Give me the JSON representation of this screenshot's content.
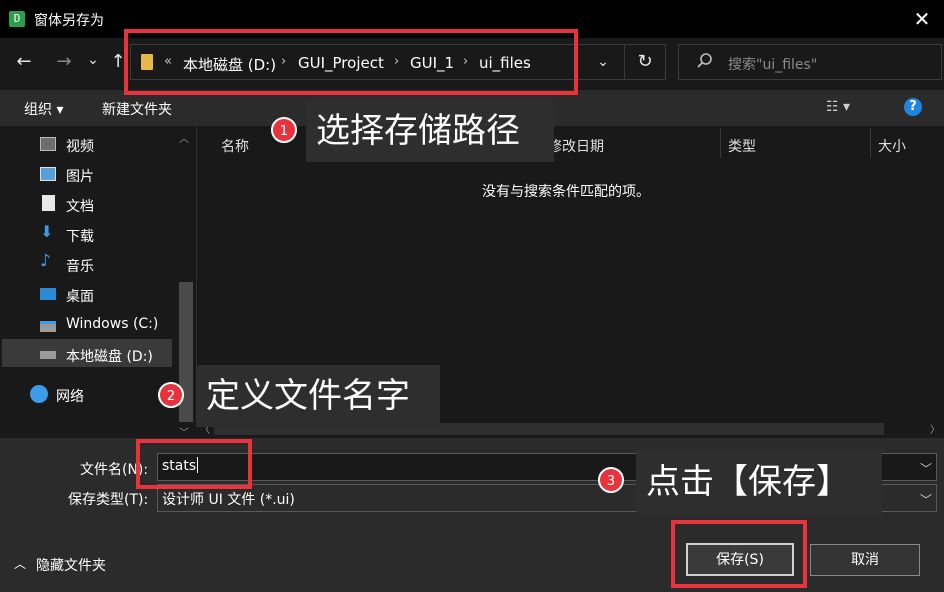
{
  "window": {
    "app_icon_letter": "D",
    "title": "窗体另存为",
    "close": "✕"
  },
  "nav": {
    "back": "←",
    "forward": "→",
    "recent": "⌄",
    "up": "↑",
    "breadcrumb_prefix": "«",
    "breadcrumbs": [
      "本地磁盘 (D:)",
      "GUI_Project",
      "GUI_1",
      "ui_files"
    ],
    "sep": "›",
    "dropdown": "⌄",
    "refresh": "↻",
    "search_placeholder": "搜索\"ui_files\""
  },
  "toolbar": {
    "organize": "组织 ▾",
    "new_folder": "新建文件夹",
    "view": "☷ ▾",
    "help": "?"
  },
  "sidebar": {
    "items": [
      {
        "label": "视频",
        "icon": "video-icon"
      },
      {
        "label": "图片",
        "icon": "picture-icon"
      },
      {
        "label": "文档",
        "icon": "document-icon"
      },
      {
        "label": "下载",
        "icon": "download-icon"
      },
      {
        "label": "音乐",
        "icon": "music-icon"
      },
      {
        "label": "桌面",
        "icon": "desktop-icon"
      },
      {
        "label": "Windows (C:)",
        "icon": "drive-icon"
      },
      {
        "label": "本地磁盘 (D:)",
        "icon": "drive-icon"
      }
    ],
    "network": "网络"
  },
  "list": {
    "columns": [
      "名称",
      "修改日期",
      "类型",
      "大小"
    ],
    "empty_message": "没有与搜索条件匹配的项。"
  },
  "form": {
    "filename_label": "文件名(N):",
    "filename_value": "stats",
    "filetype_label": "保存类型(T):",
    "filetype_value": "设计师 UI 文件 (*.ui)",
    "hide_folders": "隐藏文件夹",
    "save": "保存(S)",
    "cancel": "取消"
  },
  "annotations": [
    {
      "number": "1",
      "text": "选择存储路径"
    },
    {
      "number": "2",
      "text": "定义文件名字"
    },
    {
      "number": "3",
      "text": "点击【保存】"
    }
  ],
  "colors": {
    "annotation_red": "#e8323c",
    "accent_blue": "#1f86e0"
  }
}
